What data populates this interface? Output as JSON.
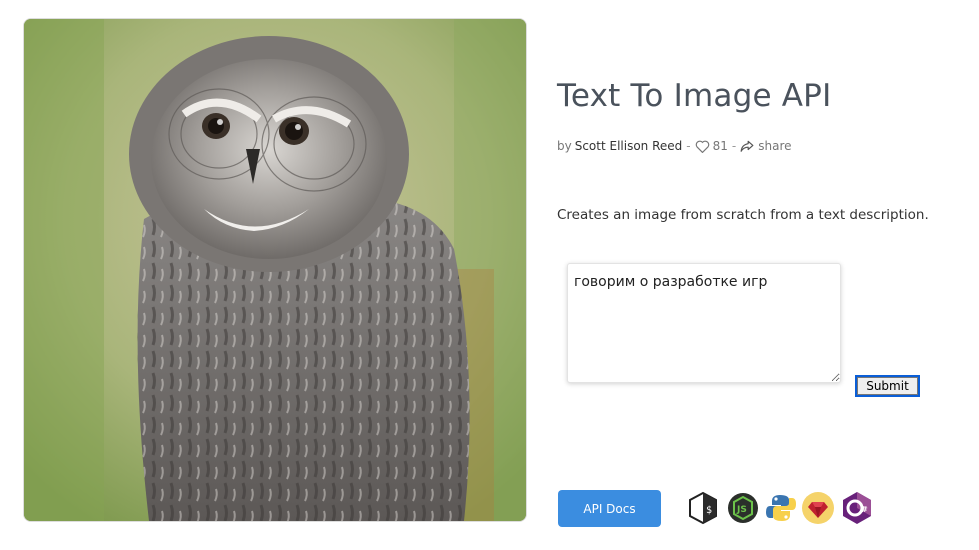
{
  "page": {
    "title": "Text To Image API",
    "byline_prefix": "by",
    "author": "Scott Ellison Reed",
    "separator": "-",
    "like_count": "81",
    "share_label": "share",
    "description": "Creates an image from scratch from a text description."
  },
  "form": {
    "prompt_value": "говорим о разработке игр",
    "submit_label": "Submit"
  },
  "footer": {
    "docs_label": "API Docs",
    "language_icons": [
      "shell-icon",
      "nodejs-icon",
      "python-icon",
      "ruby-icon",
      "csharp-icon"
    ]
  },
  "colors": {
    "accent": "#3b8de0",
    "title": "#4a525c",
    "ruby_badge": "#f5d36a",
    "csharp": "#68217a",
    "nodejs": "#3c873a"
  }
}
